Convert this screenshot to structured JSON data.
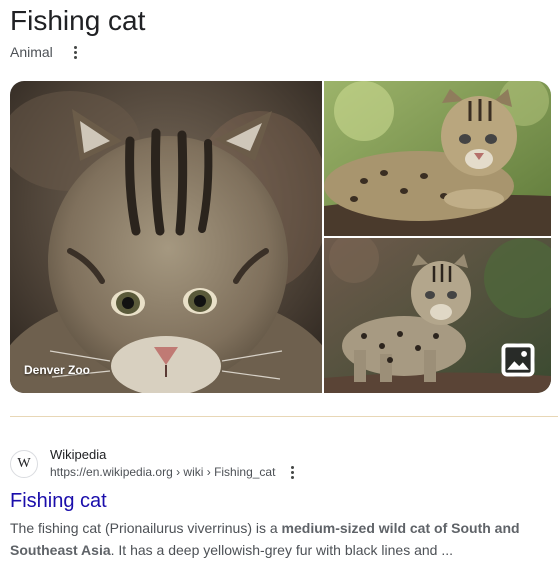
{
  "panel": {
    "title": "Fishing cat",
    "subtitle": "Animal"
  },
  "gallery": {
    "main_caption": "Denver Zoo",
    "images": [
      {
        "icon": "fishing-cat-portrait-image"
      },
      {
        "icon": "fishing-cat-lying-on-log-image"
      },
      {
        "icon": "fishing-cat-standing-image"
      }
    ],
    "more_images_icon": "image-icon"
  },
  "result": {
    "site_name": "Wikipedia",
    "favicon_letter": "W",
    "url": "https://en.wikipedia.org › wiki › Fishing_cat",
    "title": "Fishing cat",
    "snippet": {
      "part1": "The fishing cat (Prionailurus viverrinus) is a ",
      "bold1": "medium-sized wild cat of South and Southeast Asia",
      "part2": ". It has a deep yellowish-grey fur with black lines and ..."
    }
  },
  "colors": {
    "link": "#1a0dab",
    "divider": "#e8d7b6",
    "text_secondary": "#4d5156"
  }
}
